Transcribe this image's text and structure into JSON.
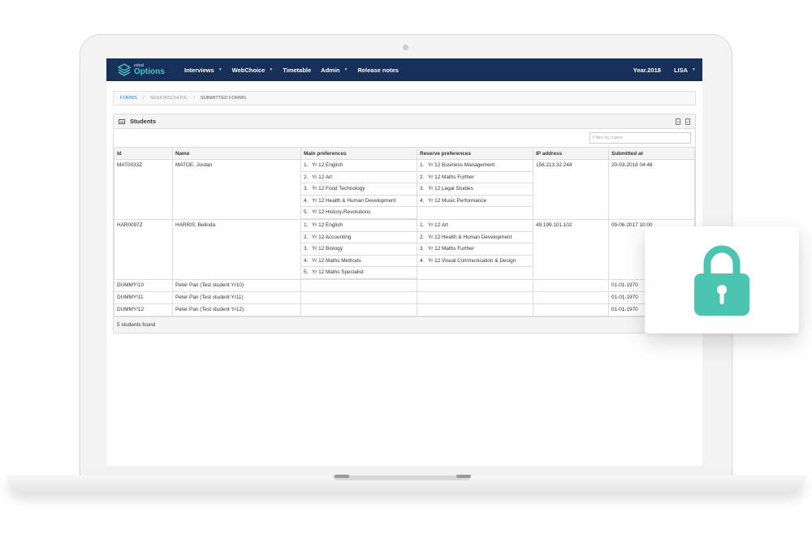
{
  "brand": {
    "small": "edval",
    "name": "Options"
  },
  "nav": {
    "items": [
      {
        "label": "Interviews",
        "dropdown": true
      },
      {
        "label": "WebChoice",
        "dropdown": true
      },
      {
        "label": "Timetable",
        "dropdown": false
      },
      {
        "label": "Admin",
        "dropdown": true
      },
      {
        "label": "Release notes",
        "dropdown": false
      }
    ],
    "year": "Year.2018",
    "user": "LISA"
  },
  "breadcrumb": {
    "first": "FORMS",
    "second": "SENIORSCHOOL",
    "third": "SUBMITTED FORMS"
  },
  "panel": {
    "title": "Students"
  },
  "filter": {
    "placeholder": "Filter by name",
    "value": ""
  },
  "table": {
    "headers": [
      "Id",
      "Name",
      "Main preferences",
      "Reserve preferences",
      "IP address",
      "Submitted at"
    ],
    "rows": [
      {
        "id": "MAT0033Z",
        "name": "MATOE, Jordan",
        "main": [
          "Yr 12 English",
          "Yr 12 Art",
          "Yr 12 Food Technology",
          "Yr 12 Health & Human Development",
          "Yr 12 History-Revolutions"
        ],
        "reserve": [
          "Yr 12 Business Management",
          "Yr 12 Maths Further",
          "Yr 12 Legal Studies",
          "Yr 12 Music Performance"
        ],
        "ip": "156.213.32.244",
        "submitted": "20-03-2018 04:48"
      },
      {
        "id": "HAR0097Z",
        "name": "HARRIS, Belinda",
        "main": [
          "Yr 12 English",
          "Yr 12 Accounting",
          "Yr 12 Biology",
          "Yr 12 Maths Methods",
          "Yr 12 Maths Specialist"
        ],
        "reserve": [
          "Yr 12 Art",
          "Yr 12 Health & Human Development",
          "Yr 12 Maths Further",
          "Yr 12 Visual Communication & Design"
        ],
        "ip": "49.199.101.102",
        "submitted": "09-06-2017 10:00"
      },
      {
        "id": "DUMMY!10",
        "name": "Peter Pan (Test student Yr10)",
        "main": [],
        "reserve": [],
        "ip": "",
        "submitted": "01-01-1970"
      },
      {
        "id": "DUMMY!11",
        "name": "Peter Pan (Test student Yr11)",
        "main": [],
        "reserve": [],
        "ip": "",
        "submitted": "01-01-1970"
      },
      {
        "id": "DUMMY!12",
        "name": "Peter Pan (Test student Yr12)",
        "main": [],
        "reserve": [],
        "ip": "",
        "submitted": "01-01-1970"
      }
    ]
  },
  "footer": {
    "count_text": "5 students found"
  },
  "colors": {
    "navbar": "#16305a",
    "brand_accent": "#4ec5c1",
    "lock": "#4cc4b2",
    "link": "#2a7ab8"
  },
  "icons": {
    "lock": "padlock-icon",
    "export_xls": "file-excel-icon",
    "export_pdf": "file-pdf-icon",
    "students": "list-icon"
  }
}
